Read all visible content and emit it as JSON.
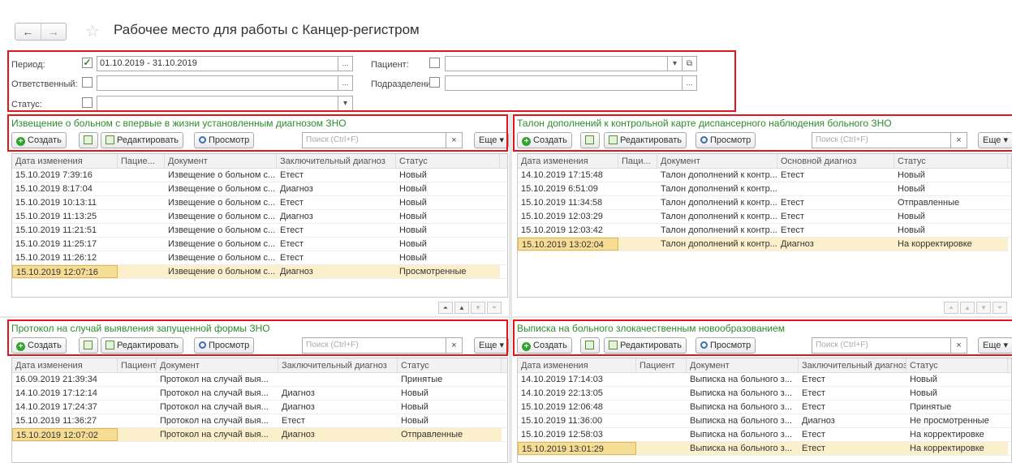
{
  "window": {
    "title": "Рабочее место для работы с Канцер-регистром"
  },
  "filters": {
    "period_label": "Период:",
    "period_value": "01.10.2019 - 31.10.2019",
    "patient_label": "Пациент:",
    "responsible_label": "Ответственный:",
    "department_label": "Подразделение:",
    "status_label": "Статус:",
    "ellipsis": "...",
    "dropdown": "▾",
    "open": "⧉"
  },
  "toolbar": {
    "create": "Создать",
    "edit": "Редактировать",
    "view": "Просмотр",
    "search_placeholder": "Поиск (Ctrl+F)",
    "clear": "×",
    "more": "Еще ▾"
  },
  "panels": {
    "p1": {
      "title": "Извещение о больном с впервые в жизни установленным диагнозом ЗНО",
      "columns": [
        "Дата изменения",
        "Пацие...",
        "Документ",
        "Заключительный диагноз",
        "Статус"
      ],
      "rows": [
        [
          "15.10.2019 7:39:16",
          "",
          "Извещение о больном с...",
          "Етест",
          "Новый"
        ],
        [
          "15.10.2019 8:17:04",
          "",
          "Извещение о больном с...",
          "Диагноз",
          "Новый"
        ],
        [
          "15.10.2019 10:13:11",
          "",
          "Извещение о больном с...",
          "Етест",
          "Новый"
        ],
        [
          "15.10.2019 11:13:25",
          "",
          "Извещение о больном с...",
          "Диагноз",
          "Новый"
        ],
        [
          "15.10.2019 11:21:51",
          "",
          "Извещение о больном с...",
          "Етест",
          "Новый"
        ],
        [
          "15.10.2019 11:25:17",
          "",
          "Извещение о больном с...",
          "Етест",
          "Новый"
        ],
        [
          "15.10.2019 11:26:12",
          "",
          "Извещение о больном с...",
          "Етест",
          "Новый"
        ],
        [
          "15.10.2019 12:07:16",
          "",
          "Извещение о больном с...",
          "Диагноз",
          "Просмотренные"
        ]
      ]
    },
    "p2": {
      "title": "Талон дополнений к контрольной карте диспансерного наблюдения больного ЗНО",
      "columns": [
        "Дата изменения",
        "Паци...",
        "Документ",
        "Основной диагноз",
        "Статус"
      ],
      "rows": [
        [
          "14.10.2019 17:15:48",
          "",
          "Талон дополнений к контр...",
          "Етест",
          "Новый"
        ],
        [
          "15.10.2019 6:51:09",
          "",
          "Талон дополнений к контр...",
          "",
          "Новый"
        ],
        [
          "15.10.2019 11:34:58",
          "",
          "Талон дополнений к контр...",
          "Етест",
          "Отправленные"
        ],
        [
          "15.10.2019 12:03:29",
          "",
          "Талон дополнений к контр...",
          "Етест",
          "Новый"
        ],
        [
          "15.10.2019 12:03:42",
          "",
          "Талон дополнений к контр...",
          "Етест",
          "Новый"
        ],
        [
          "15.10.2019 13:02:04",
          "",
          "Талон дополнений к контр...",
          "Диагноз",
          "На корректировке"
        ]
      ]
    },
    "p3": {
      "title": "Протокол на случай выявления запущенной формы ЗНО",
      "columns": [
        "Дата изменения",
        "Пациент",
        "Документ",
        "Заключительный диагноз",
        "Статус"
      ],
      "rows": [
        [
          "16.09.2019 21:39:34",
          "",
          "Протокол на случай выя...",
          "",
          "Принятые"
        ],
        [
          "14.10.2019 17:12:14",
          "",
          "Протокол на случай выя...",
          "Диагноз",
          "Новый"
        ],
        [
          "14.10.2019 17:24:37",
          "",
          "Протокол на случай выя...",
          "Диагноз",
          "Новый"
        ],
        [
          "15.10.2019 11:36:27",
          "",
          "Протокол на случай выя...",
          "Етест",
          "Новый"
        ],
        [
          "15.10.2019 12:07:02",
          "",
          "Протокол на случай выя...",
          "Диагноз",
          "Отправленные"
        ]
      ]
    },
    "p4": {
      "title": "Выписка на больного злокачественным новообразованием",
      "columns": [
        "Дата изменения",
        "Пациент",
        "Документ",
        "Заключительный диагноз",
        "Статус"
      ],
      "rows": [
        [
          "14.10.2019 17:14:03",
          "",
          "Выписка на больного з...",
          "Етест",
          "Новый"
        ],
        [
          "14.10.2019 22:13:05",
          "",
          "Выписка на больного з...",
          "Етест",
          "Новый"
        ],
        [
          "15.10.2019 12:06:48",
          "",
          "Выписка на больного з...",
          "Етест",
          "Принятые"
        ],
        [
          "15.10.2019 11:36:00",
          "",
          "Выписка на больного з...",
          "Диагноз",
          "Не просмотренные"
        ],
        [
          "15.10.2019 12:58:03",
          "",
          "Выписка на больного з...",
          "Етест",
          "На корректировке"
        ],
        [
          "15.10.2019 13:01:29",
          "",
          "Выписка на больного з...",
          "Етест",
          "На корректировке"
        ]
      ]
    }
  },
  "colors": {
    "accent_green": "#2e8b2e",
    "highlight_red": "#e3151a",
    "selected_row": "#fbefcc"
  }
}
